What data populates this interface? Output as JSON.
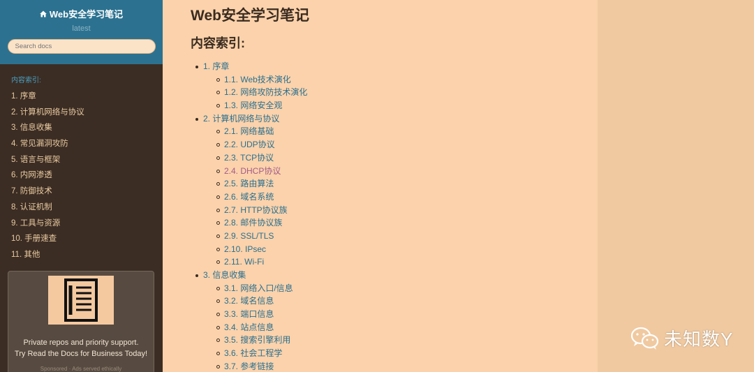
{
  "sidebar": {
    "brand": "Web安全学习笔记",
    "version": "latest",
    "search_placeholder": "Search docs",
    "caption": "内容索引:",
    "items": [
      "1. 序章",
      "2. 计算机网络与协议",
      "3. 信息收集",
      "4. 常见漏洞攻防",
      "5. 语言与框架",
      "6. 内网渗透",
      "7. 防御技术",
      "8. 认证机制",
      "9. 工具与资源",
      "10. 手册速查",
      "11. 其他"
    ],
    "promo_line1": "Private repos and priority support.",
    "promo_line2": "Try Read the Docs for Business Today!",
    "promo_sponsor": "Sponsored · Ads served ethically"
  },
  "main": {
    "title": "Web安全学习笔记",
    "section": "内容索引:",
    "toc": [
      {
        "label": "1. 序章",
        "children": [
          "1.1. Web技术演化",
          "1.2. 网络攻防技术演化",
          "1.3. 网络安全观"
        ]
      },
      {
        "label": "2. 计算机网络与协议",
        "children": [
          "2.1. 网络基础",
          "2.2. UDP协议",
          "2.3. TCP协议",
          "2.4. DHCP协议",
          "2.5. 路由算法",
          "2.6. 域名系统",
          "2.7. HTTP协议族",
          "2.8. 邮件协议族",
          "2.9. SSL/TLS",
          "2.10. IPsec",
          "2.11. Wi-Fi"
        ]
      },
      {
        "label": "3. 信息收集",
        "children": [
          "3.1. 网络入口/信息",
          "3.2. 域名信息",
          "3.3. 端口信息",
          "3.4. 站点信息",
          "3.5. 搜索引擎利用",
          "3.6. 社会工程学",
          "3.7. 参考链接"
        ]
      }
    ],
    "visited_link": "2.4. DHCP协议"
  },
  "watermark": {
    "text": "未知数Y",
    "icon": "wechat-icon"
  },
  "colors": {
    "sidebar_top": "#2c7290",
    "sidebar_bg": "#3b2d24",
    "content_bg": "#fbd2ab",
    "link": "#2a6f8f",
    "visited": "#a35a8a"
  }
}
